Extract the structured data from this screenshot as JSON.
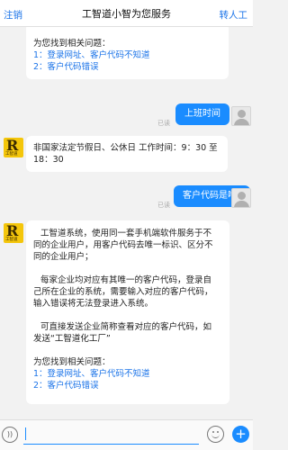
{
  "header": {
    "left_label": "注销",
    "title": "工智道小智为您服务",
    "right_label": "转人工"
  },
  "messages": {
    "bot1": {
      "intro": "为您找到相关问题：",
      "links": [
        "1：登录网址、客户代码不知道",
        "2：客户代码错误"
      ]
    },
    "user1": {
      "text": "上班时间",
      "read": "已读"
    },
    "bot2": {
      "lines": [
        "非国家法定节假日、公休日 工作时间：9：30 至",
        "18：30"
      ]
    },
    "user2": {
      "text": "客户代码是啥?",
      "read": "已读"
    },
    "bot3": {
      "p1": [
        "工智道系统，使用同一套手机端软件服务于不",
        "同的企业用户，用客户代码去唯一标识、区分不",
        "同的企业用户；"
      ],
      "p2": [
        "每家企业均对应有其唯一的客户代码，登录自",
        "己所在企业的系统，需要输入对应的客户代码，",
        "输入错误将无法登录进入系统。"
      ],
      "p3": [
        "可直接发送企业简称查看对应的客户代码，如",
        "发送“工智道化工厂”"
      ],
      "intro": "为您找到相关问题：",
      "links": [
        "1：登录网址、客户代码不知道",
        "2：客户代码错误"
      ]
    },
    "bot_avatar_caption": "工智道"
  },
  "input": {
    "placeholder": ""
  },
  "colors": {
    "accent": "#1a8cff",
    "link": "#1a73e8",
    "avatar_bot": "#f4c60b"
  }
}
